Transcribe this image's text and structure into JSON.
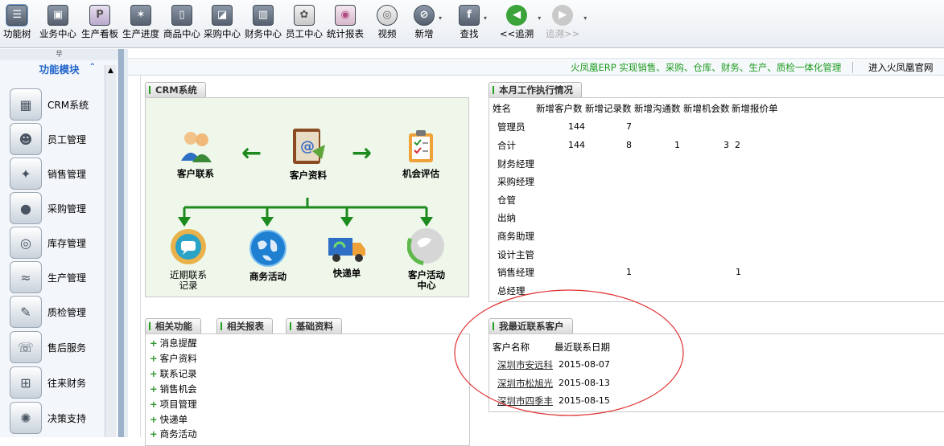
{
  "toolbar": {
    "items": [
      {
        "label": "功能树",
        "icon": "function-tree-icon"
      },
      {
        "label": "业务中心",
        "icon": "business-center-icon"
      },
      {
        "label": "生产看板",
        "icon": "production-board-icon"
      },
      {
        "label": "生产进度",
        "icon": "production-progress-icon"
      },
      {
        "label": "商品中心",
        "icon": "product-center-icon"
      },
      {
        "label": "采购中心",
        "icon": "purchase-center-icon"
      },
      {
        "label": "财务中心",
        "icon": "finance-center-icon"
      },
      {
        "label": "员工中心",
        "icon": "employee-center-icon"
      },
      {
        "label": "统计报表",
        "icon": "statistics-report-icon"
      },
      {
        "label": "视频",
        "icon": "video-icon"
      },
      {
        "label": "新增",
        "icon": "add-new-icon"
      },
      {
        "label": "查找",
        "icon": "search-icon"
      },
      {
        "label": "<<追溯",
        "icon": "back-arrow-icon"
      },
      {
        "label": "追溯>>",
        "icon": "forward-arrow-icon"
      }
    ]
  },
  "sidebar": {
    "split_glyph": "무",
    "title": "功能模块",
    "items": [
      {
        "label": "CRM系统",
        "icon": "crm-icon"
      },
      {
        "label": "员工管理",
        "icon": "employee-management-icon"
      },
      {
        "label": "销售管理",
        "icon": "sales-management-icon"
      },
      {
        "label": "采购管理",
        "icon": "purchase-management-icon"
      },
      {
        "label": "库存管理",
        "icon": "inventory-management-icon"
      },
      {
        "label": "生产管理",
        "icon": "production-management-icon"
      },
      {
        "label": "质检管理",
        "icon": "quality-management-icon"
      },
      {
        "label": "售后服务",
        "icon": "after-sales-icon"
      },
      {
        "label": "往来财务",
        "icon": "accounts-icon"
      },
      {
        "label": "决策支持",
        "icon": "decision-support-icon"
      }
    ]
  },
  "header": {
    "slogan": "火凤凰ERP 实现销售、采购、仓库、财务、生产、质检一体化管理",
    "site_link": "进入火凤凰官网"
  },
  "crm": {
    "tab": "CRM系统",
    "top_nodes": [
      "客户联系",
      "客户资料",
      "机会评估"
    ],
    "bottom_nodes": [
      "近期联系\n记录",
      "商务活动",
      "快递单",
      "客户活动\n中心"
    ]
  },
  "related": {
    "tabs": [
      "相关功能",
      "相关报表",
      "基础资料"
    ],
    "items": [
      "消息提醒",
      "客户资料",
      "联系记录",
      "销售机会",
      "项目管理",
      "快递单",
      "商务活动"
    ]
  },
  "monthly": {
    "tab": "本月工作执行情况",
    "headers": [
      "姓名",
      "新增客户数",
      "新增记录数",
      "新增沟通数",
      "新增机会数",
      "新增报价单"
    ],
    "rows": [
      {
        "name": "管理员",
        "c1": "144",
        "c2": "7",
        "c3": "",
        "c4": "",
        "c5": ""
      },
      {
        "name": "合计",
        "c1": "144",
        "c2": "8",
        "c3": "1",
        "c4": "3",
        "c5": "2"
      },
      {
        "name": "财务经理",
        "c1": "",
        "c2": "",
        "c3": "",
        "c4": "",
        "c5": ""
      },
      {
        "name": "采购经理",
        "c1": "",
        "c2": "",
        "c3": "",
        "c4": "",
        "c5": ""
      },
      {
        "name": "仓管",
        "c1": "",
        "c2": "",
        "c3": "",
        "c4": "",
        "c5": ""
      },
      {
        "name": "出纳",
        "c1": "",
        "c2": "",
        "c3": "",
        "c4": "",
        "c5": ""
      },
      {
        "name": "商务助理",
        "c1": "",
        "c2": "",
        "c3": "",
        "c4": "",
        "c5": ""
      },
      {
        "name": "设计主管",
        "c1": "",
        "c2": "",
        "c3": "",
        "c4": "",
        "c5": ""
      },
      {
        "name": "销售经理",
        "c1": "",
        "c2": "1",
        "c3": "",
        "c4": "1",
        "c5": ""
      },
      {
        "name": "总经理",
        "c1": "",
        "c2": "",
        "c3": "",
        "c4": "",
        "c5": ""
      }
    ]
  },
  "recent": {
    "tab": "我最近联系客户",
    "headers": [
      "客户名称",
      "最近联系日期"
    ],
    "rows": [
      {
        "name": "深圳市安远科",
        "date": "2015-08-07"
      },
      {
        "name": "深圳市松旭光",
        "date": "2015-08-13"
      },
      {
        "name": "深圳市四季丰",
        "date": "2015-08-15"
      }
    ]
  },
  "colors": {
    "accent_green": "#1e9a1e",
    "annotation_red": "#e03030",
    "link_blue": "#2266cc"
  }
}
